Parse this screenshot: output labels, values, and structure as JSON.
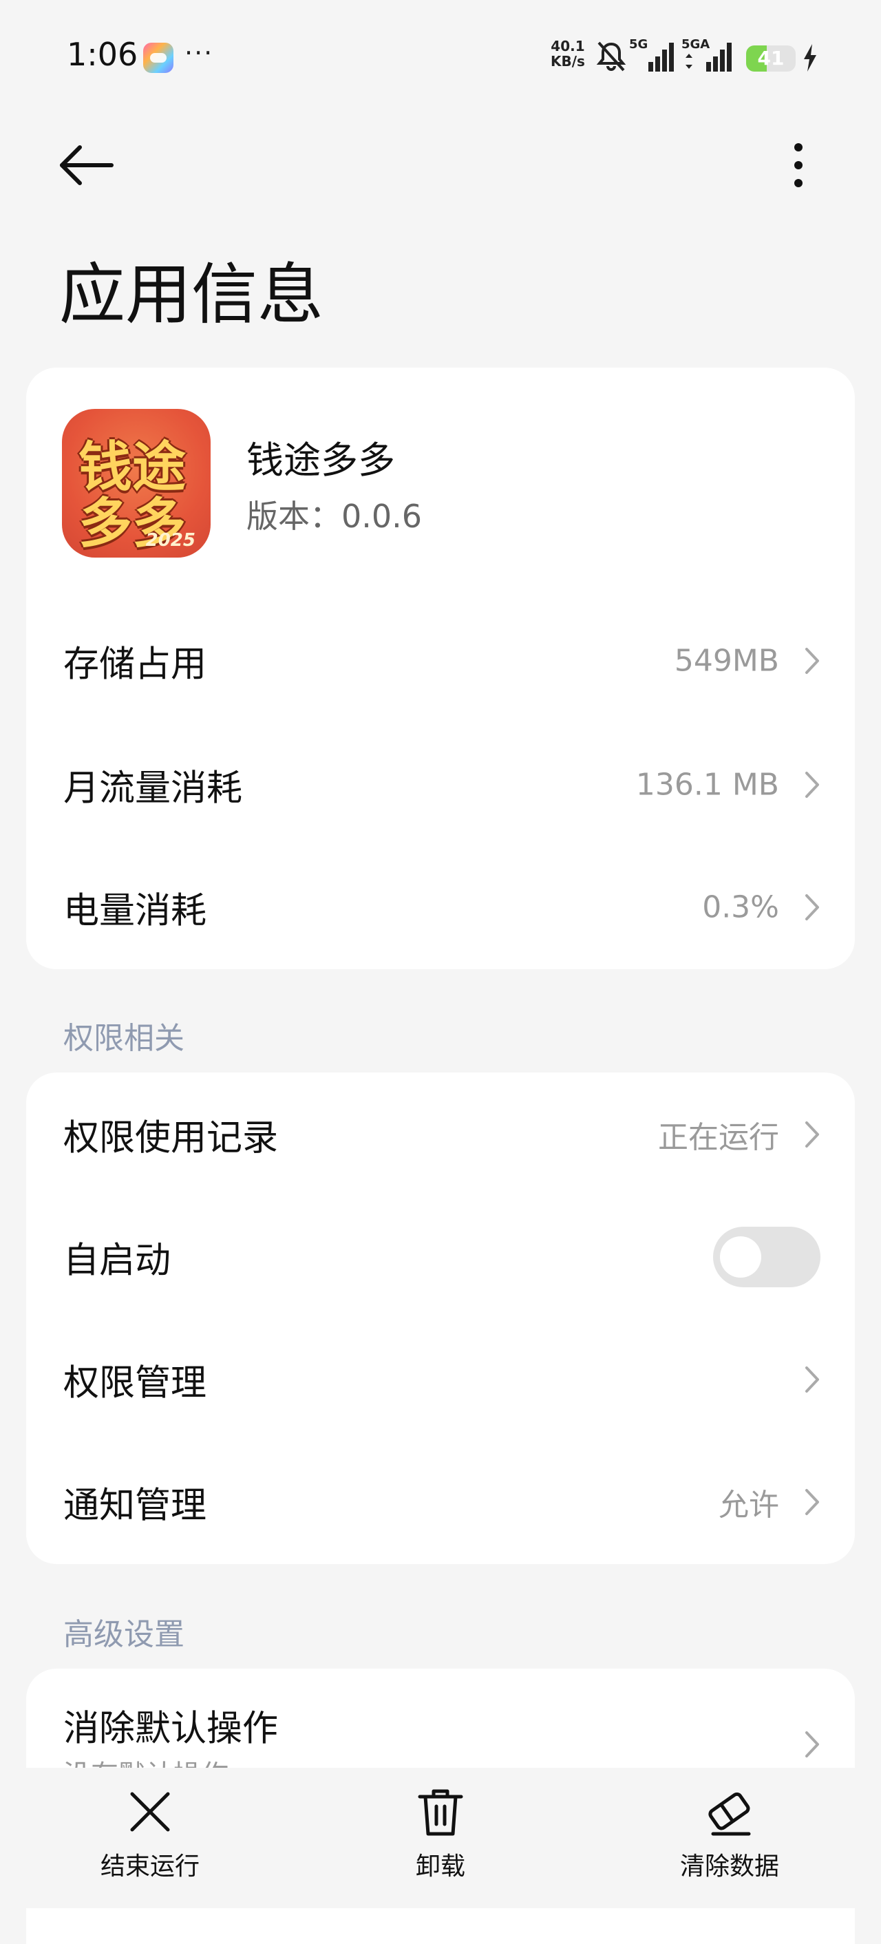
{
  "status_bar": {
    "time": "1:06",
    "more": "···",
    "net_speed_value": "40.1",
    "net_speed_unit": "KB/s",
    "sim1": "5G",
    "sim2": "5GA",
    "battery_level": "41",
    "battery_fraction": 0.41,
    "battery_color": "#7ed54f"
  },
  "header": {
    "title": "应用信息"
  },
  "app": {
    "name": "钱途多多",
    "version": "版本：0.0.6",
    "icon_text": [
      "钱途",
      "多多"
    ],
    "icon_year": "2025"
  },
  "usage": {
    "storage_label": "存储占用",
    "storage_value": "549MB",
    "data_label": "月流量消耗",
    "data_value": "136.1 MB",
    "battery_label": "电量消耗",
    "battery_value": "0.3%"
  },
  "permissions": {
    "section_title": "权限相关",
    "usage_record_label": "权限使用记录",
    "usage_record_value": "正在运行",
    "autostart_label": "自启动",
    "autostart_on": false,
    "manage_label": "权限管理",
    "notify_label": "通知管理",
    "notify_value": "允许"
  },
  "advanced": {
    "section_title": "高级设置",
    "clear_defaults_label": "消除默认操作",
    "clear_defaults_sub": "没有默认操作"
  },
  "bottom_bar": {
    "force_stop": "结束运行",
    "uninstall": "卸载",
    "clear_data": "清除数据"
  },
  "colors": {
    "background": "#f5f5f5",
    "card": "#ffffff",
    "section_header": "#8f9ab0",
    "secondary_text": "#9a9a9a"
  }
}
